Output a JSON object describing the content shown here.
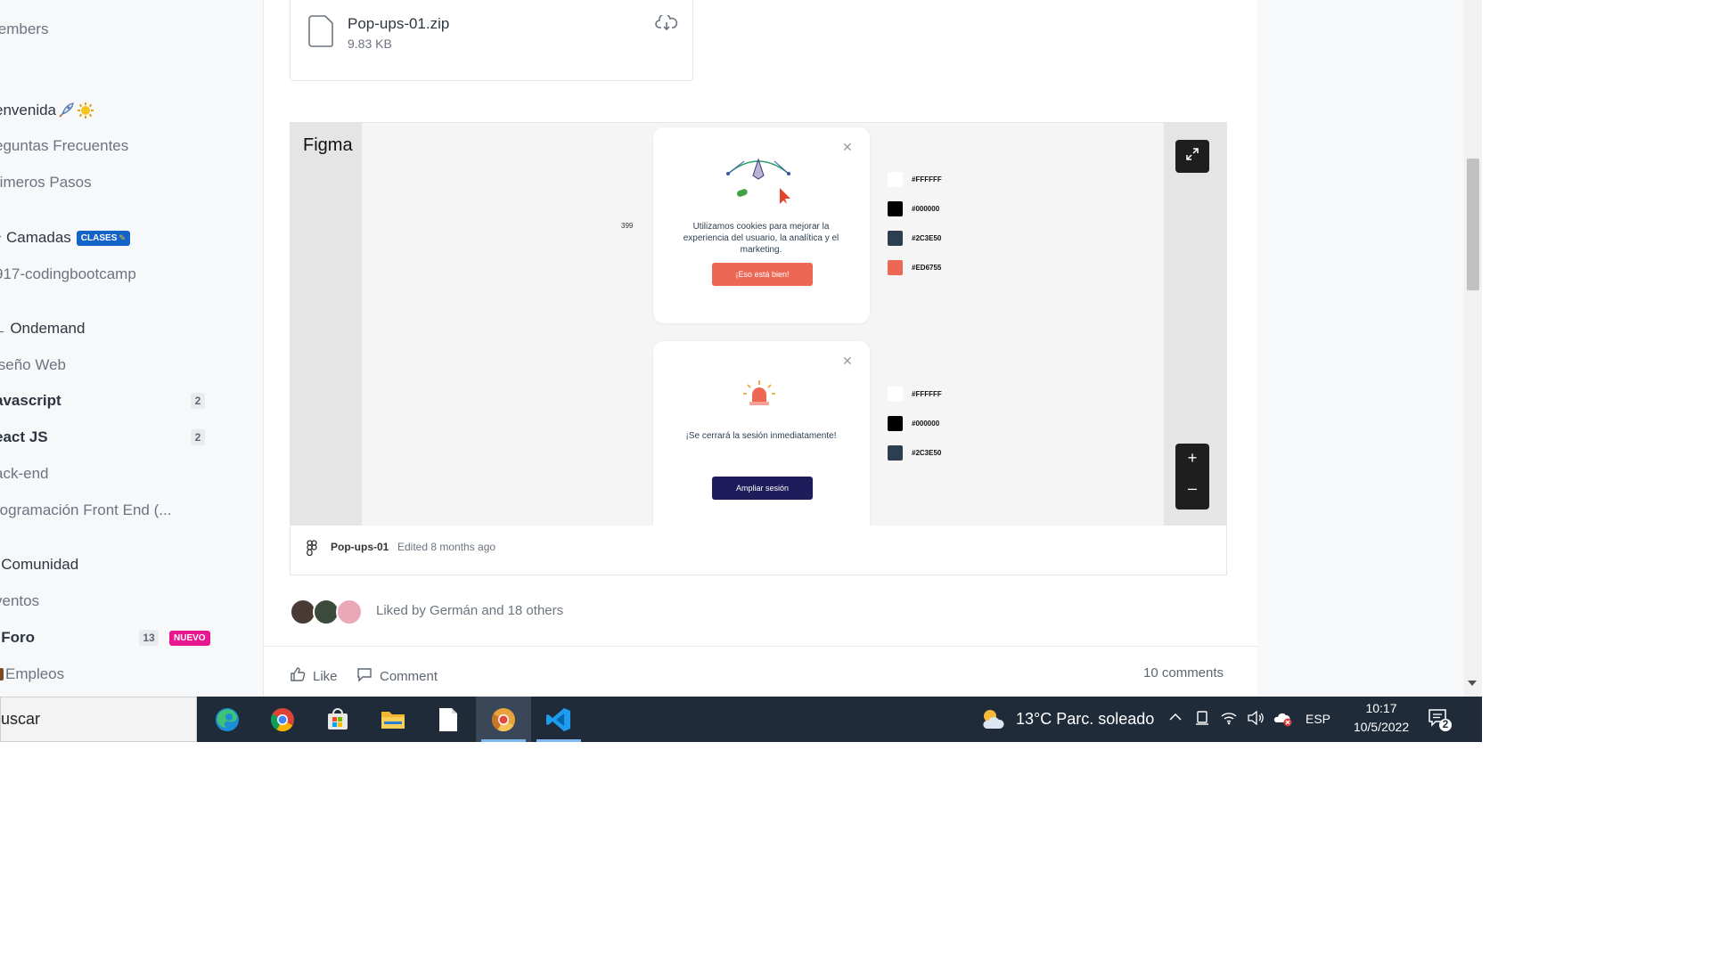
{
  "sidebar": {
    "items": [
      {
        "label": "lembers"
      },
      {
        "label": "envenida",
        "emoji_icons": [
          "rocket-icon",
          "sun-icon"
        ]
      },
      {
        "label": "eguntas Frecuentes"
      },
      {
        "label": "rimeros Pasos"
      },
      {
        "label": "Camadas",
        "badge": "CLASES"
      },
      {
        "label": "917-codingbootcamp"
      },
      {
        "label": "Ondemand"
      },
      {
        "label": "iseño Web"
      },
      {
        "label": "avascript",
        "count": "2"
      },
      {
        "label": "eact JS",
        "count": "2"
      },
      {
        "label": "ack-end"
      },
      {
        "label": "rogramación Front End (..."
      },
      {
        "label": "Comunidad"
      },
      {
        "label": "ventos"
      },
      {
        "label": "Foro",
        "count": "13",
        "badge": "NUEVO"
      },
      {
        "label": "Empleos"
      }
    ]
  },
  "file": {
    "name": "Pop-ups-01.zip",
    "size": "9.83 KB"
  },
  "figma": {
    "brand": "Figma",
    "dimension_label": "399",
    "popup1": {
      "text": "Utilizamos cookies para mejorar la experiencia del usuario, la analítica y el marketing.",
      "button": "¡Eso está bien!"
    },
    "popup2": {
      "text": "¡Se cerrará la sesión inmediatamente!",
      "button": "Ampliar sesión"
    },
    "swatches1": [
      {
        "label": "#FFFFFF",
        "color": "#FFFFFF"
      },
      {
        "label": "#000000",
        "color": "#000000"
      },
      {
        "label": "#2C3E50",
        "color": "#2C3E50"
      },
      {
        "label": "#ED6755",
        "color": "#ED6755"
      }
    ],
    "swatches2": [
      {
        "label": "#FFFFFF",
        "color": "#FFFFFF"
      },
      {
        "label": "#000000",
        "color": "#000000"
      },
      {
        "label": "#2C3E50",
        "color": "#2C3E50"
      }
    ],
    "file_name": "Pop-ups-01",
    "edited": "Edited 8 months ago",
    "zoom_in": "+",
    "zoom_out": "–"
  },
  "post": {
    "liked_by": "Liked by Germán and 18 others",
    "like_label": "Like",
    "comment_label": "Comment",
    "comments_count": "10 comments"
  },
  "taskbar": {
    "search_text": "uscar",
    "apps": [
      "edge-icon",
      "chrome-icon",
      "store-icon",
      "file-explorer-icon",
      "notepad-icon",
      "chrome-canary-icon",
      "vscode-icon"
    ],
    "weather": "13°C  Parc. soleado",
    "language": "ESP",
    "time": "10:17",
    "date": "10/5/2022",
    "notifications": "2"
  },
  "colors": {
    "accent_blue": "#1463c6",
    "badge_pink": "#e8168f",
    "figma_orange": "#ED6755",
    "figma_navy": "#1f1c5c",
    "taskbar": "#202b3a"
  }
}
